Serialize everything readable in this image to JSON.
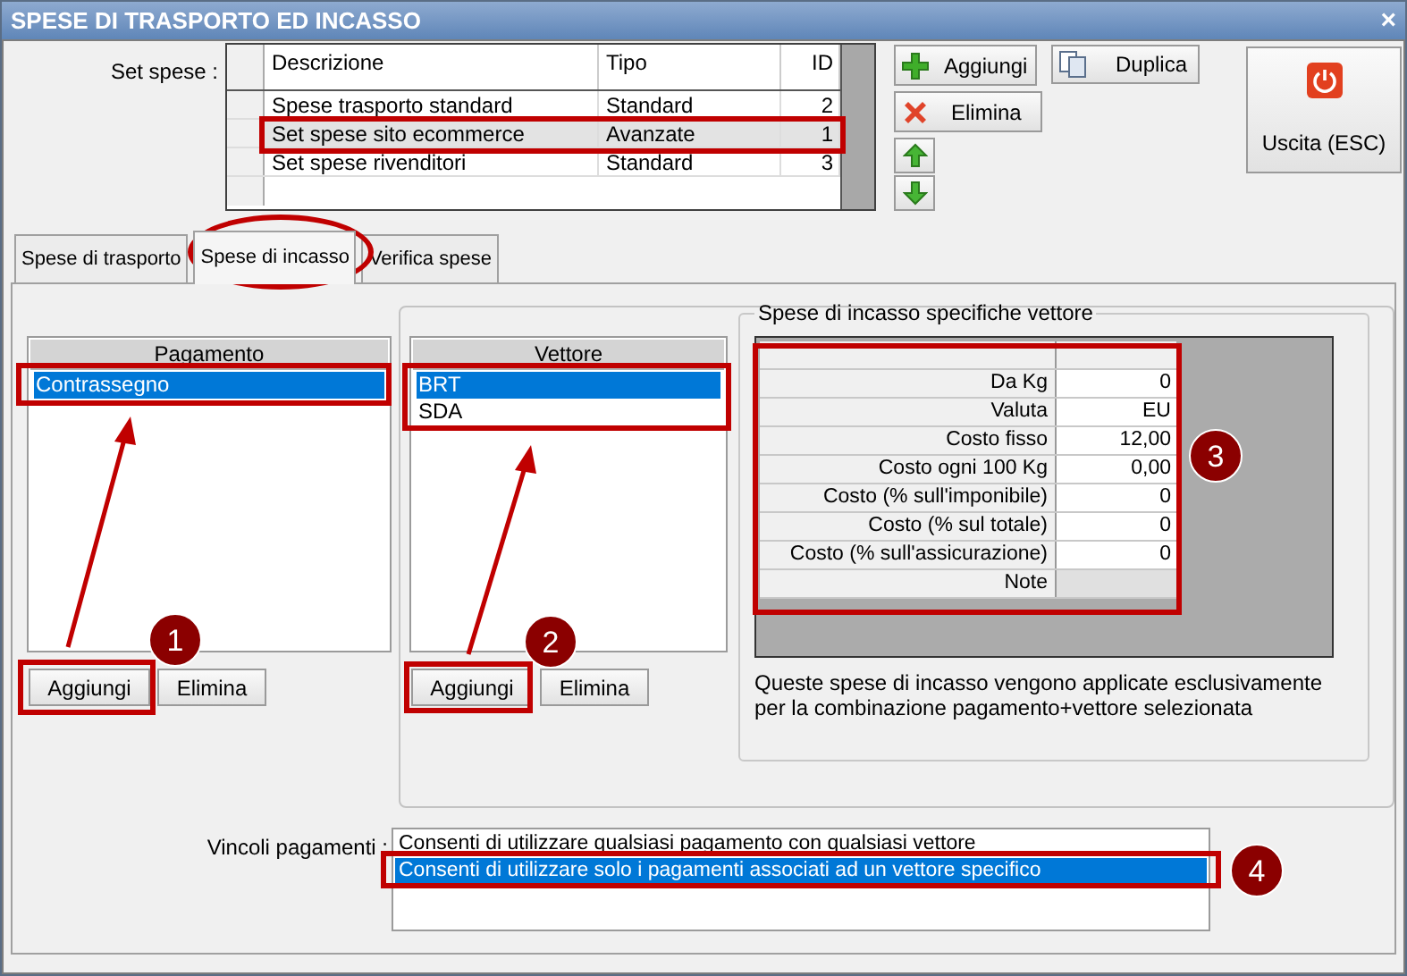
{
  "window": {
    "title": "SPESE DI TRASPORTO ED INCASSO",
    "close": "×"
  },
  "set_spese": {
    "label": "Set spese :",
    "columns": [
      "Descrizione",
      "Tipo",
      "ID"
    ],
    "rows": [
      {
        "cells": [
          "Spese trasporto standard",
          "Standard",
          "2"
        ],
        "selected": false
      },
      {
        "cells": [
          "Set spese sito ecommerce",
          "Avanzate",
          "1"
        ],
        "selected": true
      },
      {
        "cells": [
          "Set spese rivenditori",
          "Standard",
          "3"
        ],
        "selected": false
      }
    ]
  },
  "toolbar": {
    "add": "Aggiungi",
    "duplicate": "Duplica",
    "delete": "Elimina",
    "exit": "Uscita (ESC)"
  },
  "tabs": [
    {
      "label": "Spese di trasporto",
      "selected": false
    },
    {
      "label": "Spese di incasso",
      "selected": true
    },
    {
      "label": "Verifica spese",
      "selected": false
    }
  ],
  "pagamento": {
    "header": "Pagamento",
    "items": [
      {
        "label": "Contrassegno",
        "selected": true
      }
    ],
    "buttons": [
      "Aggiungi",
      "Elimina"
    ]
  },
  "vettore": {
    "header": "Vettore",
    "items": [
      {
        "label": "BRT",
        "selected": true
      },
      {
        "label": "SDA",
        "selected": false
      }
    ],
    "buttons": [
      "Aggiungi",
      "Elimina"
    ]
  },
  "specific": {
    "title": "Spese di incasso specifiche vettore",
    "rows": [
      {
        "label": "Da Kg",
        "value": "0"
      },
      {
        "label": "Valuta",
        "value": "EU"
      },
      {
        "label": "Costo fisso",
        "value": "12,00"
      },
      {
        "label": "Costo ogni 100 Kg",
        "value": "0,00"
      },
      {
        "label": "Costo (% sull'imponibile)",
        "value": "0"
      },
      {
        "label": "Costo (% sul totale)",
        "value": "0"
      },
      {
        "label": "Costo (% sull'assicurazione)",
        "value": "0"
      },
      {
        "label": "Note"
      }
    ],
    "footer": "Queste spese di incasso vengono applicate esclusivamente per la combinazione pagamento+vettore selezionata"
  },
  "vincoli": {
    "label": "Vincoli pagamenti :",
    "options": [
      {
        "label": "Consenti di utilizzare qualsiasi pagamento con qualsiasi vettore",
        "selected": false
      },
      {
        "label": "Consenti di utilizzare solo i pagamenti associati ad un vettore specifico",
        "selected": true
      }
    ]
  },
  "annotations": {
    "badges": [
      "1",
      "2",
      "3",
      "4"
    ]
  }
}
